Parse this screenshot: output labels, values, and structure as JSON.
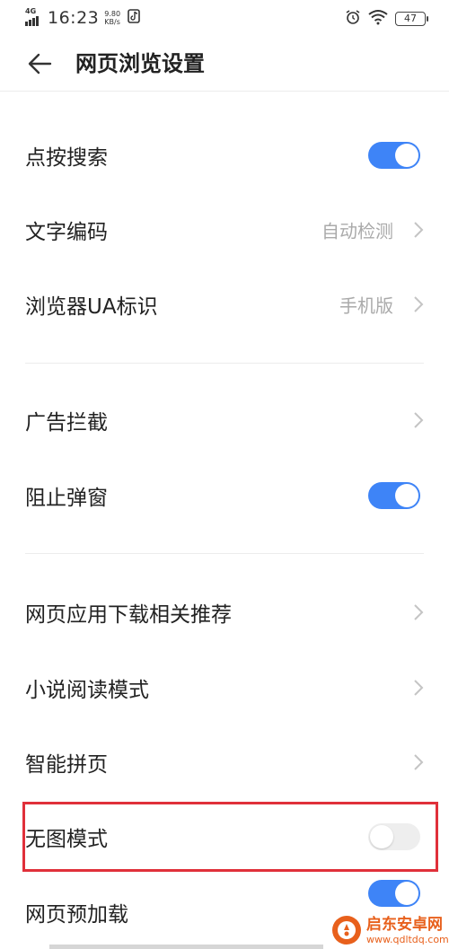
{
  "status_bar": {
    "network": "4G",
    "time": "16:23",
    "speed_value": "9.80",
    "speed_unit": "KB/s",
    "battery": "47"
  },
  "header": {
    "title": "网页浏览设置"
  },
  "sections": [
    {
      "rows": [
        {
          "label": "点按搜索",
          "control": "toggle",
          "on": true
        },
        {
          "label": "文字编码",
          "control": "chevron",
          "value": "自动检测"
        },
        {
          "label": "浏览器UA标识",
          "control": "chevron",
          "value": "手机版"
        }
      ]
    },
    {
      "rows": [
        {
          "label": "广告拦截",
          "control": "chevron"
        },
        {
          "label": "阻止弹窗",
          "control": "toggle",
          "on": true
        }
      ]
    },
    {
      "rows": [
        {
          "label": "网页应用下载相关推荐",
          "control": "chevron"
        },
        {
          "label": "小说阅读模式",
          "control": "chevron"
        },
        {
          "label": "智能拼页",
          "control": "chevron"
        },
        {
          "label": "无图模式",
          "control": "toggle",
          "on": false
        },
        {
          "label": "网页预加载",
          "control": "toggle",
          "on": true
        }
      ]
    }
  ],
  "watermark": {
    "name": "启东安卓网",
    "url": "www.qdltdq.com"
  },
  "colors": {
    "toggle_on": "#3e84f7",
    "toggle_off": "#eeeeee",
    "highlight": "#e0303a",
    "value_text": "#aaaaaa",
    "watermark": "#e8601c"
  }
}
